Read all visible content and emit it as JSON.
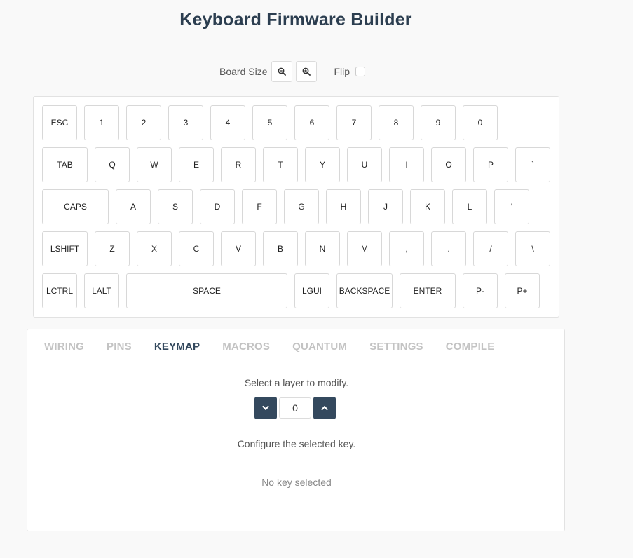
{
  "title": "Keyboard Firmware Builder",
  "controls": {
    "board_size_label": "Board Size",
    "zoom_out_icon": "zoom-out-icon",
    "zoom_in_icon": "zoom-in-icon",
    "flip_label": "Flip",
    "flip_checked": false
  },
  "keyboard": {
    "rows": [
      [
        "ESC",
        "1",
        "2",
        "3",
        "4",
        "5",
        "6",
        "7",
        "8",
        "9",
        "0"
      ],
      [
        "TAB",
        "Q",
        "W",
        "E",
        "R",
        "T",
        "Y",
        "U",
        "I",
        "O",
        "P",
        "`"
      ],
      [
        "CAPS",
        "A",
        "S",
        "D",
        "F",
        "G",
        "H",
        "J",
        "K",
        "L",
        "'"
      ],
      [
        "LSHIFT",
        "Z",
        "X",
        "C",
        "V",
        "B",
        "N",
        "M",
        ",",
        ".",
        "/",
        "\\"
      ],
      [
        "LCTRL",
        "LALT",
        "SPACE",
        "LGUI",
        "BACKSPACE",
        "ENTER",
        "P-",
        "P+"
      ]
    ]
  },
  "tabs": [
    {
      "label": "WIRING",
      "active": false
    },
    {
      "label": "PINS",
      "active": false
    },
    {
      "label": "KEYMAP",
      "active": true
    },
    {
      "label": "MACROS",
      "active": false
    },
    {
      "label": "QUANTUM",
      "active": false
    },
    {
      "label": "SETTINGS",
      "active": false
    },
    {
      "label": "COMPILE",
      "active": false
    }
  ],
  "keymap": {
    "select_layer_text": "Select a layer to modify.",
    "layer_value": "0",
    "layer_down_icon": "chevron-down-icon",
    "layer_up_icon": "chevron-up-icon",
    "configure_text": "Configure the selected key.",
    "no_key_text": "No key selected"
  }
}
